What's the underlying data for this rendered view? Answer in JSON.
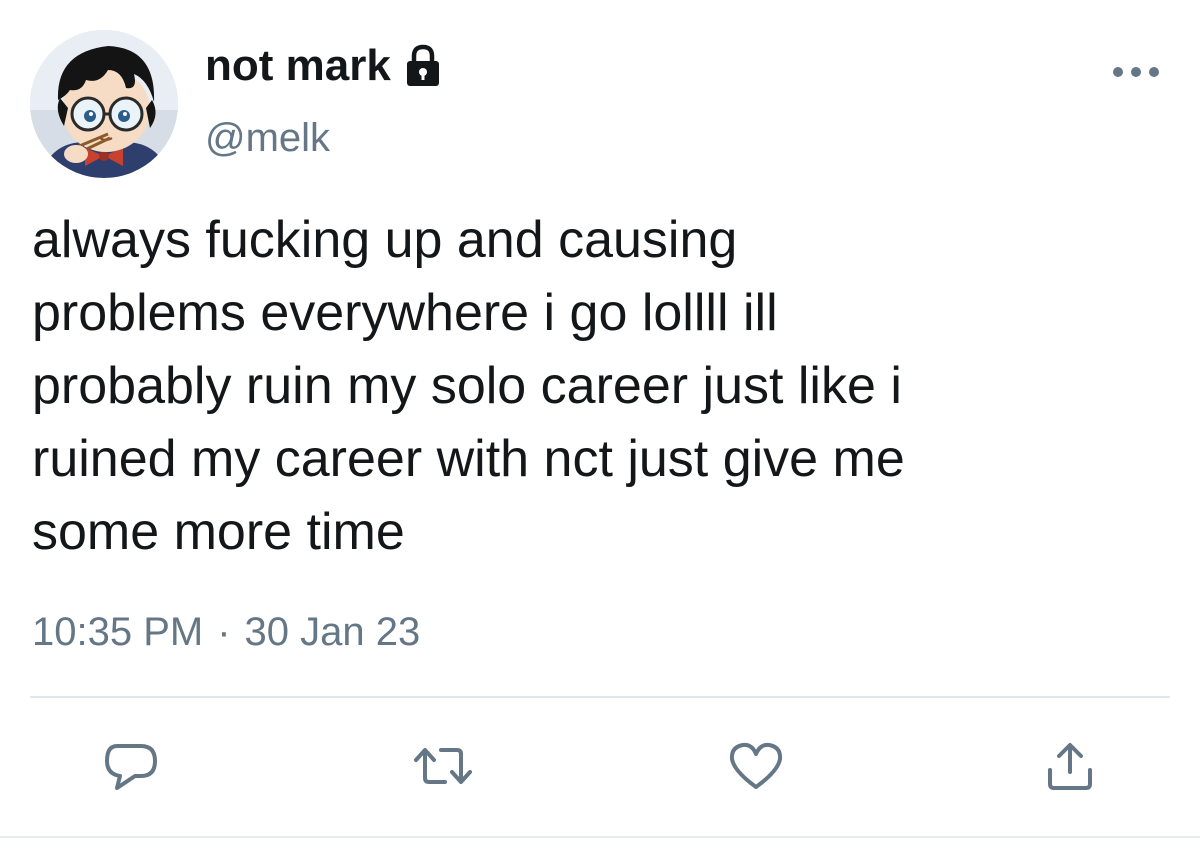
{
  "tweet": {
    "display_name": "not mark",
    "handle": "@melk",
    "text": "always fucking up and causing\nproblems everywhere i go lollll ill\nprobably ruin my solo career just like i\nruined my career with nct just give me\nsome more time",
    "time": "10:35 PM",
    "separator": "·",
    "date": "30 Jan 23",
    "protected": true
  },
  "icons": {
    "lock": "lock-icon",
    "more": "more-horizontal-icon",
    "reply": "reply-icon",
    "retweet": "retweet-icon",
    "like": "heart-icon",
    "share": "share-icon"
  },
  "colors": {
    "text": "#14171a",
    "secondary": "#657786",
    "icon": "#657786",
    "divider": "#e1e8ed"
  }
}
